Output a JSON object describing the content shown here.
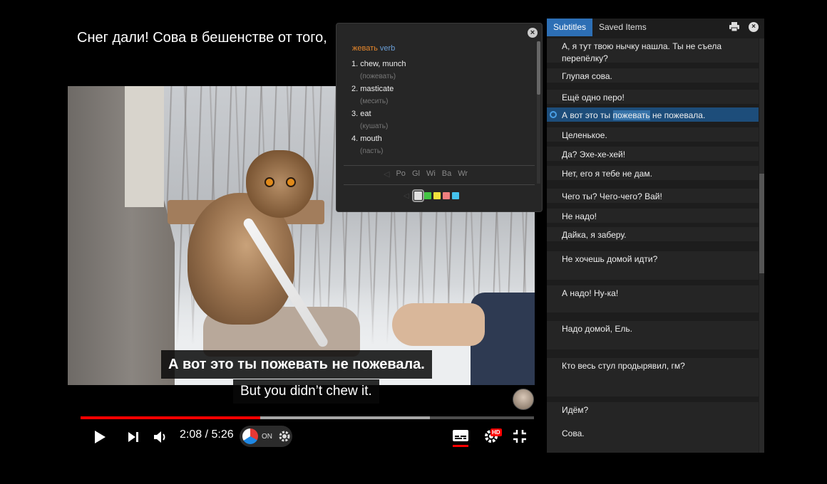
{
  "video": {
    "title": "Снег дали! Сова в бешенстве от того,",
    "subtitle_ru": "А вот это ты пожевать не пожевала.",
    "subtitle_en": "But you didn’t chew it.",
    "progress_fraction": 0.397,
    "buffer_fraction": 0.77
  },
  "controls": {
    "time": "2:08 / 5:26",
    "extension_state": "ON",
    "quality_badge": "HD",
    "icons": [
      "play-icon",
      "next-icon",
      "volume-icon",
      "gear-icon",
      "subtitles-icon",
      "settings-icon",
      "fullscreen-exit-icon"
    ]
  },
  "dictionary": {
    "word": "жевать",
    "pos": "verb",
    "entries": [
      {
        "tr": "1. chew, munch",
        "ru": "(пожевать)"
      },
      {
        "tr": "2. masticate",
        "ru": "(месить)"
      },
      {
        "tr": "3. eat",
        "ru": "(кушать)"
      },
      {
        "tr": "4. mouth",
        "ru": "(пасть)"
      }
    ],
    "sources": [
      "Po",
      "Gl",
      "Wi",
      "Ba",
      "Wr"
    ],
    "colors": [
      "#e0e0e0",
      "#43c443",
      "#f2e23c",
      "#ef7f7f",
      "#45c3ee"
    ]
  },
  "panel": {
    "tab_subtitles": "Subtitles",
    "tab_saved": "Saved Items",
    "lines": [
      {
        "text": "А, я тут твою нычку нашла. Ты не съела перепёлку?"
      },
      {
        "text": "Глупая сова."
      },
      {
        "text": "Ещё одно перо!"
      },
      {
        "pre": "А вот это ты ",
        "hl": "пожевать",
        "post": " не пожевала."
      },
      {
        "text": "Целенькое."
      },
      {
        "text": "Да? Эхе-хе-хей!"
      },
      {
        "text": "Нет, его я тебе не дам."
      },
      {
        "text": "Чего ты? Чего-чего? Вай!"
      },
      {
        "text": "Не надо!"
      },
      {
        "text": "Дайка, я заберу."
      },
      {
        "text": "Не хочешь домой идти?"
      },
      {
        "text": "А надо! Ну-ка!"
      },
      {
        "text": "Надо домой, Ель."
      },
      {
        "text": "Кто весь стул продырявил, гм?"
      },
      {
        "text": "Идём?"
      },
      {
        "text": "Сова."
      }
    ]
  }
}
